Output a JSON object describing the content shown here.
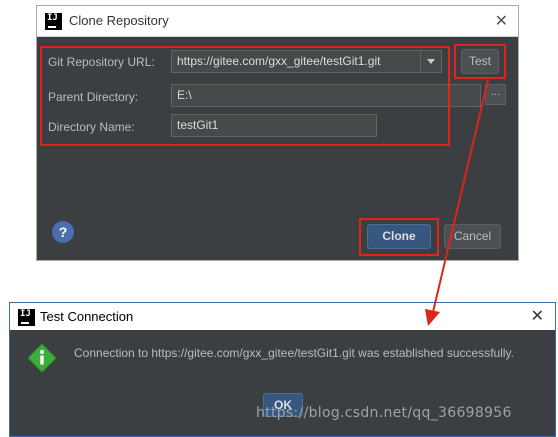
{
  "clone_dialog": {
    "title": "Clone Repository",
    "close_glyph": "✕",
    "url_label": "Git Repository URL:",
    "url_value": "https://gitee.com/gxx_gitee/testGit1.git",
    "parent_label": "Parent Directory:",
    "parent_value": "E:\\",
    "dir_label": "Directory Name:",
    "dir_value": "testGit1",
    "test_button": "Test",
    "browse_button": "...",
    "clone_button": "Clone",
    "cancel_button": "Cancel",
    "help_glyph": "?"
  },
  "test_dialog": {
    "title": "Test Connection",
    "close_glyph": "✕",
    "message": "Connection to https://gitee.com/gxx_gitee/testGit1.git was established successfully.",
    "ok_button": "OK"
  },
  "logo_text": "IJ",
  "watermark": "https://blog.csdn.net/qq_36698956",
  "colors": {
    "annotation": "#e0231d",
    "dialog_bg": "#3c3f41",
    "default_button": "#365880",
    "info_icon": "#3cae3c"
  },
  "icons": {
    "app_logo": "intellij-icon",
    "info": "information-icon",
    "help": "help-icon",
    "close": "close-icon",
    "combo": "chevron-down-icon"
  }
}
